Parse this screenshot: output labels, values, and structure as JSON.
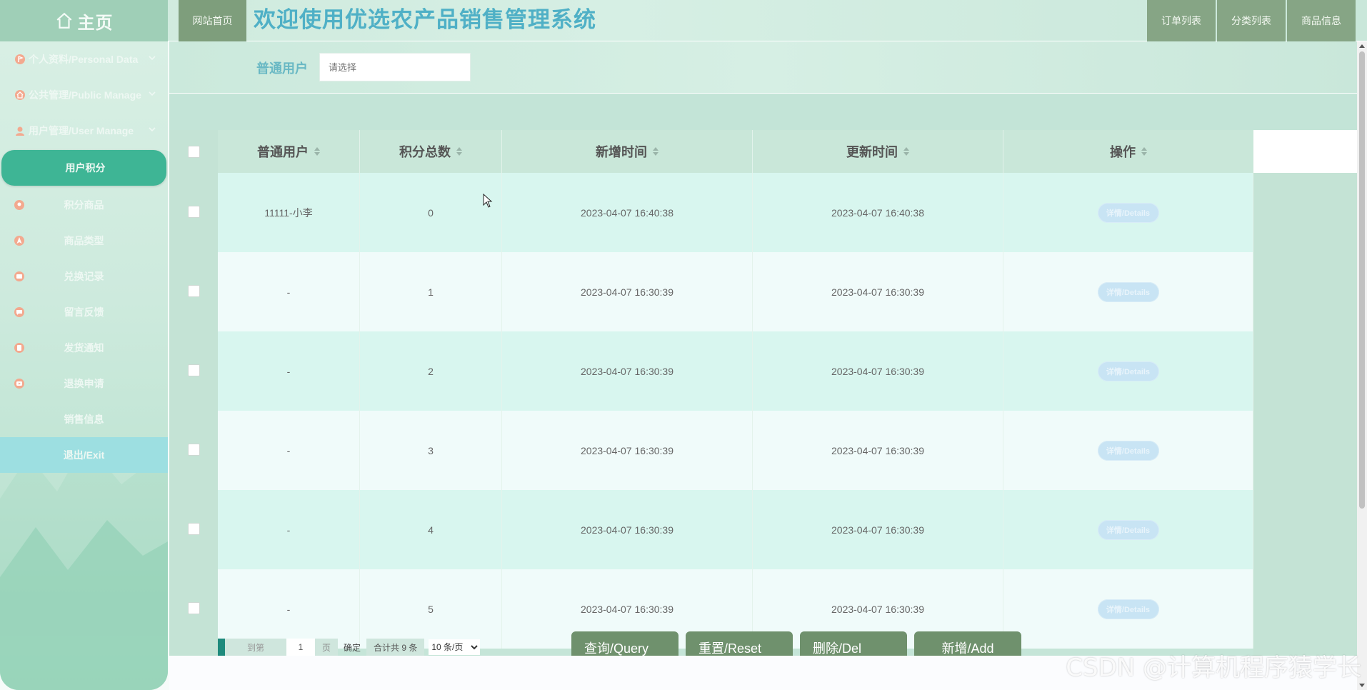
{
  "brand": {
    "title": "主页"
  },
  "header": {
    "home_link": "网站首页",
    "system_title": "欢迎使用优选农产品销售管理系统",
    "links": [
      "订单列表",
      "分类列表",
      "商品信息"
    ]
  },
  "sidebar": {
    "groups": [
      {
        "label": "个人资料/Personal Data",
        "icon": "profile-icon",
        "icon_color": "#f08a6a"
      },
      {
        "label": "公共管理/Public Manage",
        "icon": "home-icon",
        "icon_color": "#f08a6a"
      },
      {
        "label": "用户管理/User Manage",
        "icon": "user-icon",
        "icon_color": "#f08a6a"
      }
    ],
    "items": [
      {
        "label": "用户积分",
        "active": true
      },
      {
        "label": "积分商品",
        "icon": "pin-icon"
      },
      {
        "label": "商品类型",
        "icon": "nav-icon"
      },
      {
        "label": "兑换记录",
        "icon": "record-icon"
      },
      {
        "label": "留言反馈",
        "icon": "chat-icon"
      },
      {
        "label": "发货通知",
        "icon": "notice-icon"
      },
      {
        "label": "退换申请",
        "icon": "return-icon"
      },
      {
        "label": "销售信息"
      },
      {
        "label": "退出/Exit"
      }
    ]
  },
  "search": {
    "label": "普通用户",
    "placeholder": "请选择"
  },
  "table": {
    "columns": [
      "普通用户",
      "积分总数",
      "新增时间",
      "更新时间",
      "操作"
    ],
    "rows": [
      {
        "user": "11111-小李",
        "points": "0",
        "created": "2023-04-07 16:40:38",
        "updated": "2023-04-07 16:40:38",
        "action": "详情/Details"
      },
      {
        "user": "-",
        "points": "1",
        "created": "2023-04-07 16:30:39",
        "updated": "2023-04-07 16:30:39",
        "action": "详情/Details"
      },
      {
        "user": "-",
        "points": "2",
        "created": "2023-04-07 16:30:39",
        "updated": "2023-04-07 16:30:39",
        "action": "详情/Details"
      },
      {
        "user": "-",
        "points": "3",
        "created": "2023-04-07 16:30:39",
        "updated": "2023-04-07 16:30:39",
        "action": "详情/Details"
      },
      {
        "user": "-",
        "points": "4",
        "created": "2023-04-07 16:30:39",
        "updated": "2023-04-07 16:30:39",
        "action": "详情/Details"
      },
      {
        "user": "-",
        "points": "5",
        "created": "2023-04-07 16:30:39",
        "updated": "2023-04-07 16:30:39",
        "action": "详情/Details"
      }
    ]
  },
  "pager": {
    "goto_label": "到第",
    "page_value": "1",
    "page_unit": "页",
    "confirm": "确定",
    "total": "合计共 9 条",
    "page_size": "10 条/页"
  },
  "actions": {
    "query": "查询/Query",
    "reset": "重置/Reset",
    "delete": "删除/Del",
    "add": "新增/Add"
  },
  "watermark": "CSDN @计算机程序猿学长",
  "colors": {
    "accent_green": "#3eb595",
    "button_green": "#6f916d",
    "title_blue": "#4fb0c6",
    "details_blue": "#c8e4f4"
  }
}
